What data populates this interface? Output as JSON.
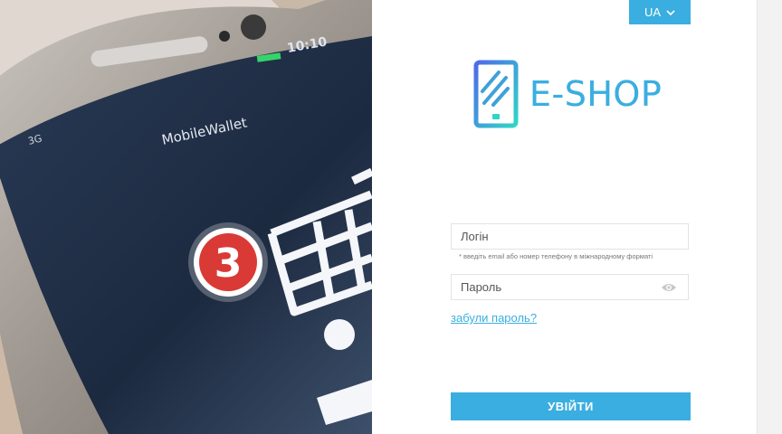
{
  "language": {
    "selected": "UA"
  },
  "brand": {
    "name": "E-SHOP"
  },
  "hero": {
    "phone_label": "MobileWallet",
    "status_time": "10:10",
    "signal": "3G",
    "cart_badge": "3"
  },
  "form": {
    "login_placeholder": "Логін",
    "login_hint": "* введіть email або номер телефону в міжнародному форматі",
    "password_placeholder": "Пароль",
    "forgot_link": "забули пароль?",
    "submit_label": "УВІЙТИ"
  },
  "colors": {
    "accent": "#3aaee0",
    "badge_red": "#d93a35",
    "screen_dark": "#1f2d45"
  },
  "icons": {
    "lang_chevron": "chevron-down-icon",
    "password_toggle": "eye-icon",
    "logo": "phone-logo-icon"
  }
}
